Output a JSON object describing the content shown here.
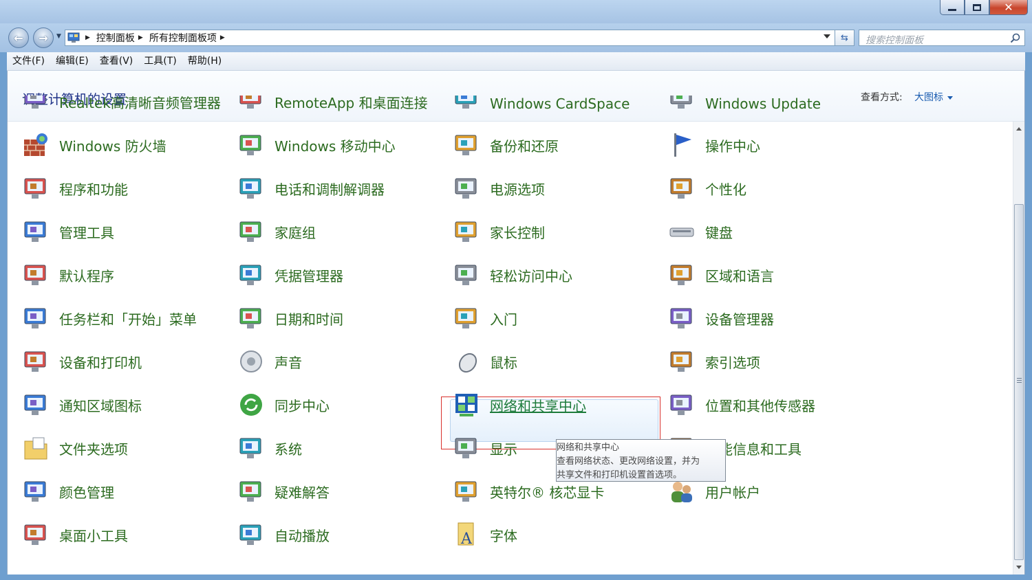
{
  "window": {
    "minimize": "–",
    "maximize": "□",
    "close": "✕"
  },
  "nav": {
    "breadcrumbs": [
      "控制面板",
      "所有控制面板项"
    ],
    "search_placeholder": "搜索控制面板"
  },
  "menu": [
    "文件(F)",
    "编辑(E)",
    "查看(V)",
    "工具(T)",
    "帮助(H)"
  ],
  "header": {
    "title": "调整计算机的设置",
    "view_by_label": "查看方式:",
    "view_by_value": "大图标"
  },
  "partial_row": [
    "Realtek高清晰音频管理器",
    "RemoteApp 和桌面连接",
    "Windows CardSpace",
    "Windows Update"
  ],
  "items": [
    [
      "Windows 防火墙",
      "Windows 移动中心",
      "备份和还原",
      "操作中心"
    ],
    [
      "程序和功能",
      "电话和调制解调器",
      "电源选项",
      "个性化"
    ],
    [
      "管理工具",
      "家庭组",
      "家长控制",
      "键盘"
    ],
    [
      "默认程序",
      "凭据管理器",
      "轻松访问中心",
      "区域和语言"
    ],
    [
      "任务栏和「开始」菜单",
      "日期和时间",
      "入门",
      "设备管理器"
    ],
    [
      "设备和打印机",
      "声音",
      "鼠标",
      "索引选项"
    ],
    [
      "通知区域图标",
      "同步中心",
      "网络和共享中心",
      "位置和其他传感器"
    ],
    [
      "文件夹选项",
      "系统",
      "显示",
      "性能信息和工具"
    ],
    [
      "颜色管理",
      "疑难解答",
      "英特尔® 核芯显卡",
      "用户帐户"
    ],
    [
      "桌面小工具",
      "自动播放",
      "字体",
      ""
    ]
  ],
  "tooltip": {
    "title": "网络和共享中心",
    "line1": "查看网络状态、更改网络设置，并为",
    "line2": "共享文件和打印机设置首选项。"
  },
  "colors": {
    "link": "#2c6b20",
    "title": "#1e3287",
    "highlight": "#d9302c"
  }
}
